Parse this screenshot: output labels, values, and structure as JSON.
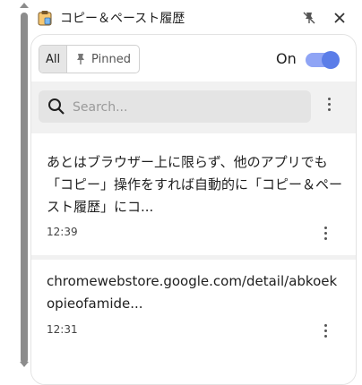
{
  "header": {
    "title": "コピー＆ペースト履歴",
    "app_icon": "clipboard-icon",
    "unpin_icon": "unpin-icon",
    "close_icon": "close-icon"
  },
  "filters": {
    "all_label": "All",
    "pinned_label": "Pinned",
    "selected": "All"
  },
  "toggle": {
    "label": "On",
    "state": "on",
    "accent_color": "#5b7de8"
  },
  "search": {
    "placeholder": "Search...",
    "value": ""
  },
  "items": [
    {
      "text": "あとはブラウザー上に限らず、他のアプリでも「コピー」操作をすれば自動的に「コピー＆ペースト履歴」にコ...",
      "time": "12:39"
    },
    {
      "text": "chromewebstore.google.com/detail/abkoekopieofamide...",
      "time": "12:31"
    }
  ]
}
